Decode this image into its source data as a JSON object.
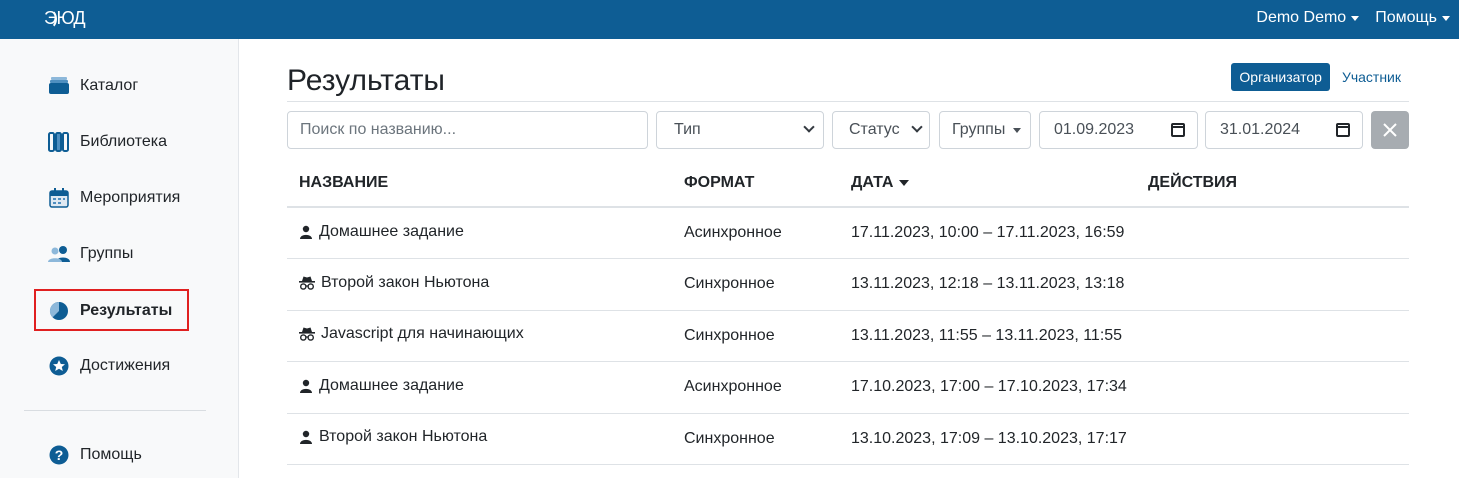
{
  "header": {
    "logo_text": "ЭЮД",
    "user_menu": "Demo Demo",
    "help_menu": "Помощь"
  },
  "sidebar": {
    "items": [
      {
        "label": "Каталог",
        "icon": "catalog-box-icon"
      },
      {
        "label": "Библиотека",
        "icon": "library-books-icon"
      },
      {
        "label": "Мероприятия",
        "icon": "calendar-icon"
      },
      {
        "label": "Группы",
        "icon": "users-icon"
      },
      {
        "label": "Результаты",
        "icon": "pie-chart-icon",
        "active": true
      },
      {
        "label": "Достижения",
        "icon": "star-badge-icon"
      },
      {
        "label": "Помощь",
        "icon": "question-circle-icon"
      }
    ]
  },
  "main": {
    "title": "Результаты",
    "roles": {
      "organizer": "Организатор",
      "participant": "Участник"
    },
    "filters": {
      "search_placeholder": "Поиск по названию...",
      "type": "Тип",
      "status": "Статус",
      "groups": "Группы",
      "date_from": "01.09.2023",
      "date_to": "31.01.2024"
    },
    "table": {
      "headers": {
        "name": "НАЗВАНИЕ",
        "format": "ФОРМАТ",
        "date": "ДАТА",
        "actions": "ДЕЙСТВИЯ"
      },
      "rows": [
        {
          "icon": "user-icon",
          "name": "Домашнее задание",
          "format": "Асинхронное",
          "date": "17.11.2023, 10:00 – 17.11.2023, 16:59"
        },
        {
          "icon": "incognito-icon",
          "name": "Второй закон Ньютона",
          "format": "Синхронное",
          "date": "13.11.2023, 12:18 – 13.11.2023, 13:18"
        },
        {
          "icon": "incognito-icon",
          "name": "Javascript для начинающих",
          "format": "Синхронное",
          "date": "13.11.2023, 11:55 – 13.11.2023, 11:55"
        },
        {
          "icon": "user-icon",
          "name": "Домашнее задание",
          "format": "Асинхронное",
          "date": "17.10.2023, 17:00 – 17.10.2023, 17:34"
        },
        {
          "icon": "user-icon",
          "name": "Второй закон Ньютона",
          "format": "Синхронное",
          "date": "13.10.2023, 17:09 – 13.10.2023, 17:17"
        }
      ]
    }
  },
  "colors": {
    "brand": "#0e5d94",
    "active_outline": "#e02020",
    "clear_button": "#a7acb1"
  }
}
